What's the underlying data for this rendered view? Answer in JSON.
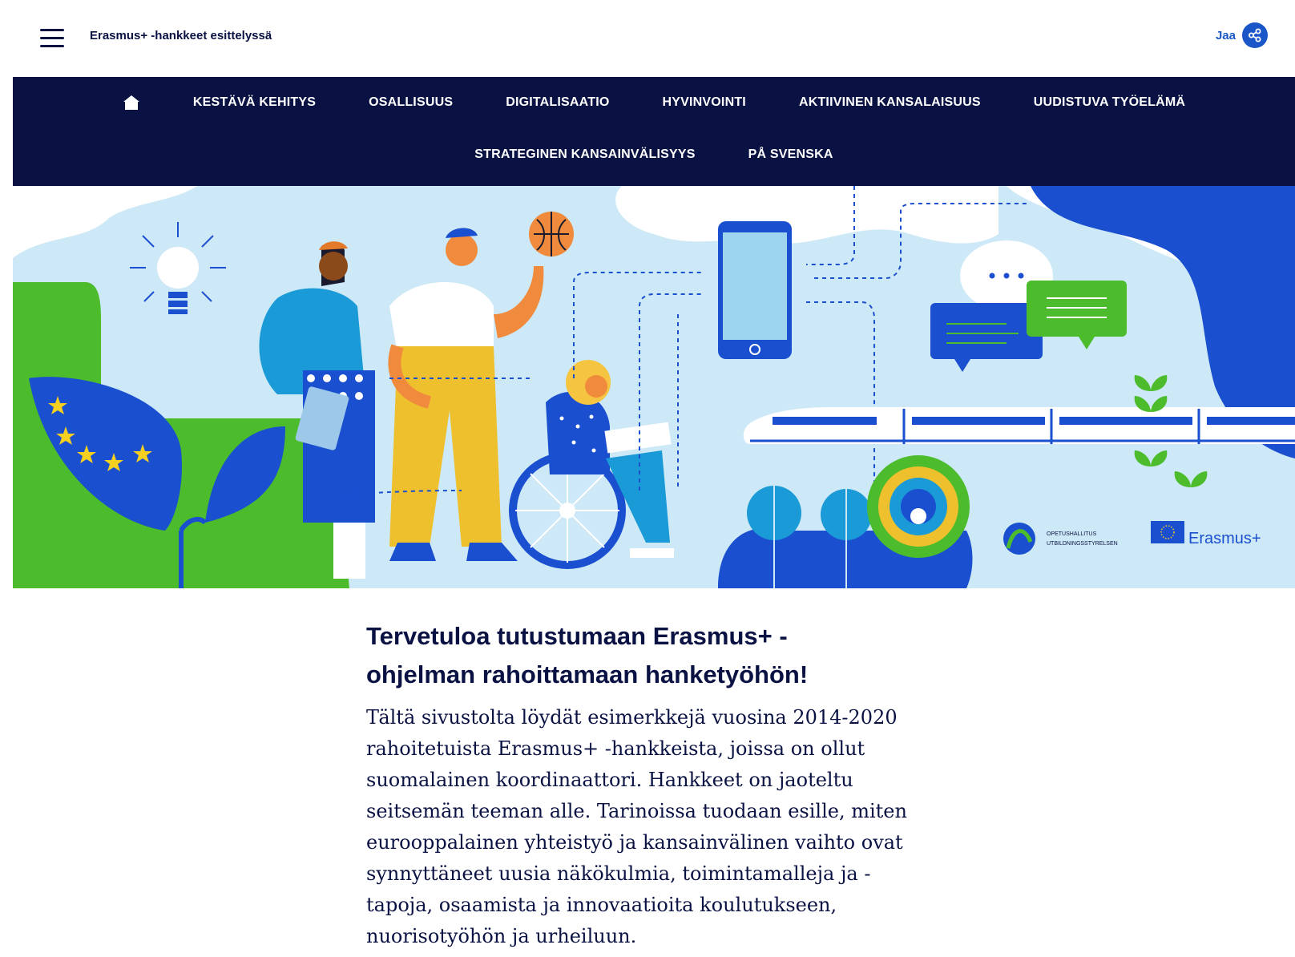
{
  "header": {
    "site_title": "Erasmus+ -hankkeet esittelyssä",
    "share_label": "Jaa"
  },
  "nav": {
    "row1": [
      "KESTÄVÄ KEHITYS",
      "OSALLISUUS",
      "DIGITALISAATIO",
      "HYVINVOINTI",
      "AKTIIVINEN KANSALAISUUS",
      "UUDISTUVA TYÖELÄMÄ"
    ],
    "row2": [
      "STRATEGINEN KANSAINVÄLISYYS",
      "PÅ SVENSKA"
    ]
  },
  "hero": {
    "logo_oph_line1": "OPETUSHALLITUS",
    "logo_oph_line2": "UTBILDNINGSSTYRELSEN",
    "logo_erasmus": "Erasmus+"
  },
  "main": {
    "headline": "Tervetuloa tutustumaan Erasmus+ -ohjelman rahoittamaan hanketyöhön!",
    "intro": "Tältä sivustolta löydät esimerkkejä vuosina 2014-2020 rahoitetuista Erasmus+ -hankkeista, joissa on ollut suomalainen koordinaattori. Hankkeet on jaoteltu seitsemän teeman alle. Tarinoissa tuodaan esille, miten eurooppalainen yhteistyö ja kansainvälinen vaihto ovat synnyttäneet uusia näkökulmia, toimintamalleja ja -tapoja, osaamista ja innovaatioita koulutukseen, nuorisotyöhön ja urheiluun."
  },
  "colors": {
    "navy": "#0a1244",
    "accent_blue": "#1a56c8",
    "hero_sky": "#cde8f6",
    "hero_green": "#4cbc2c"
  }
}
